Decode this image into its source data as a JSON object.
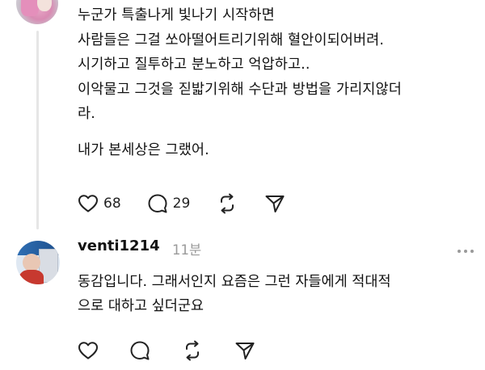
{
  "post": {
    "lines": [
      "누군가 특출나게 빛나기 시작하면",
      "사람들은 그걸 쏘아떨어트리기위해 혈안이되어버려.",
      "시기하고 질투하고 분노하고 억압하고..",
      "이악물고 그것을 짇밟기위해 수단과 방법을 가리지않더",
      "라.",
      "내가 본세상은 그랬어."
    ],
    "likes": "68",
    "replies": "29"
  },
  "reply": {
    "username": "venti1214",
    "time": "11분",
    "lines": [
      "동감입니다. 그래서인지 요즘은 그런 자들에게 적대적",
      "으로 대하고 싶더군요"
    ]
  },
  "icons": [
    "heart-icon",
    "comment-icon",
    "repost-icon",
    "share-icon",
    "more-icon"
  ]
}
